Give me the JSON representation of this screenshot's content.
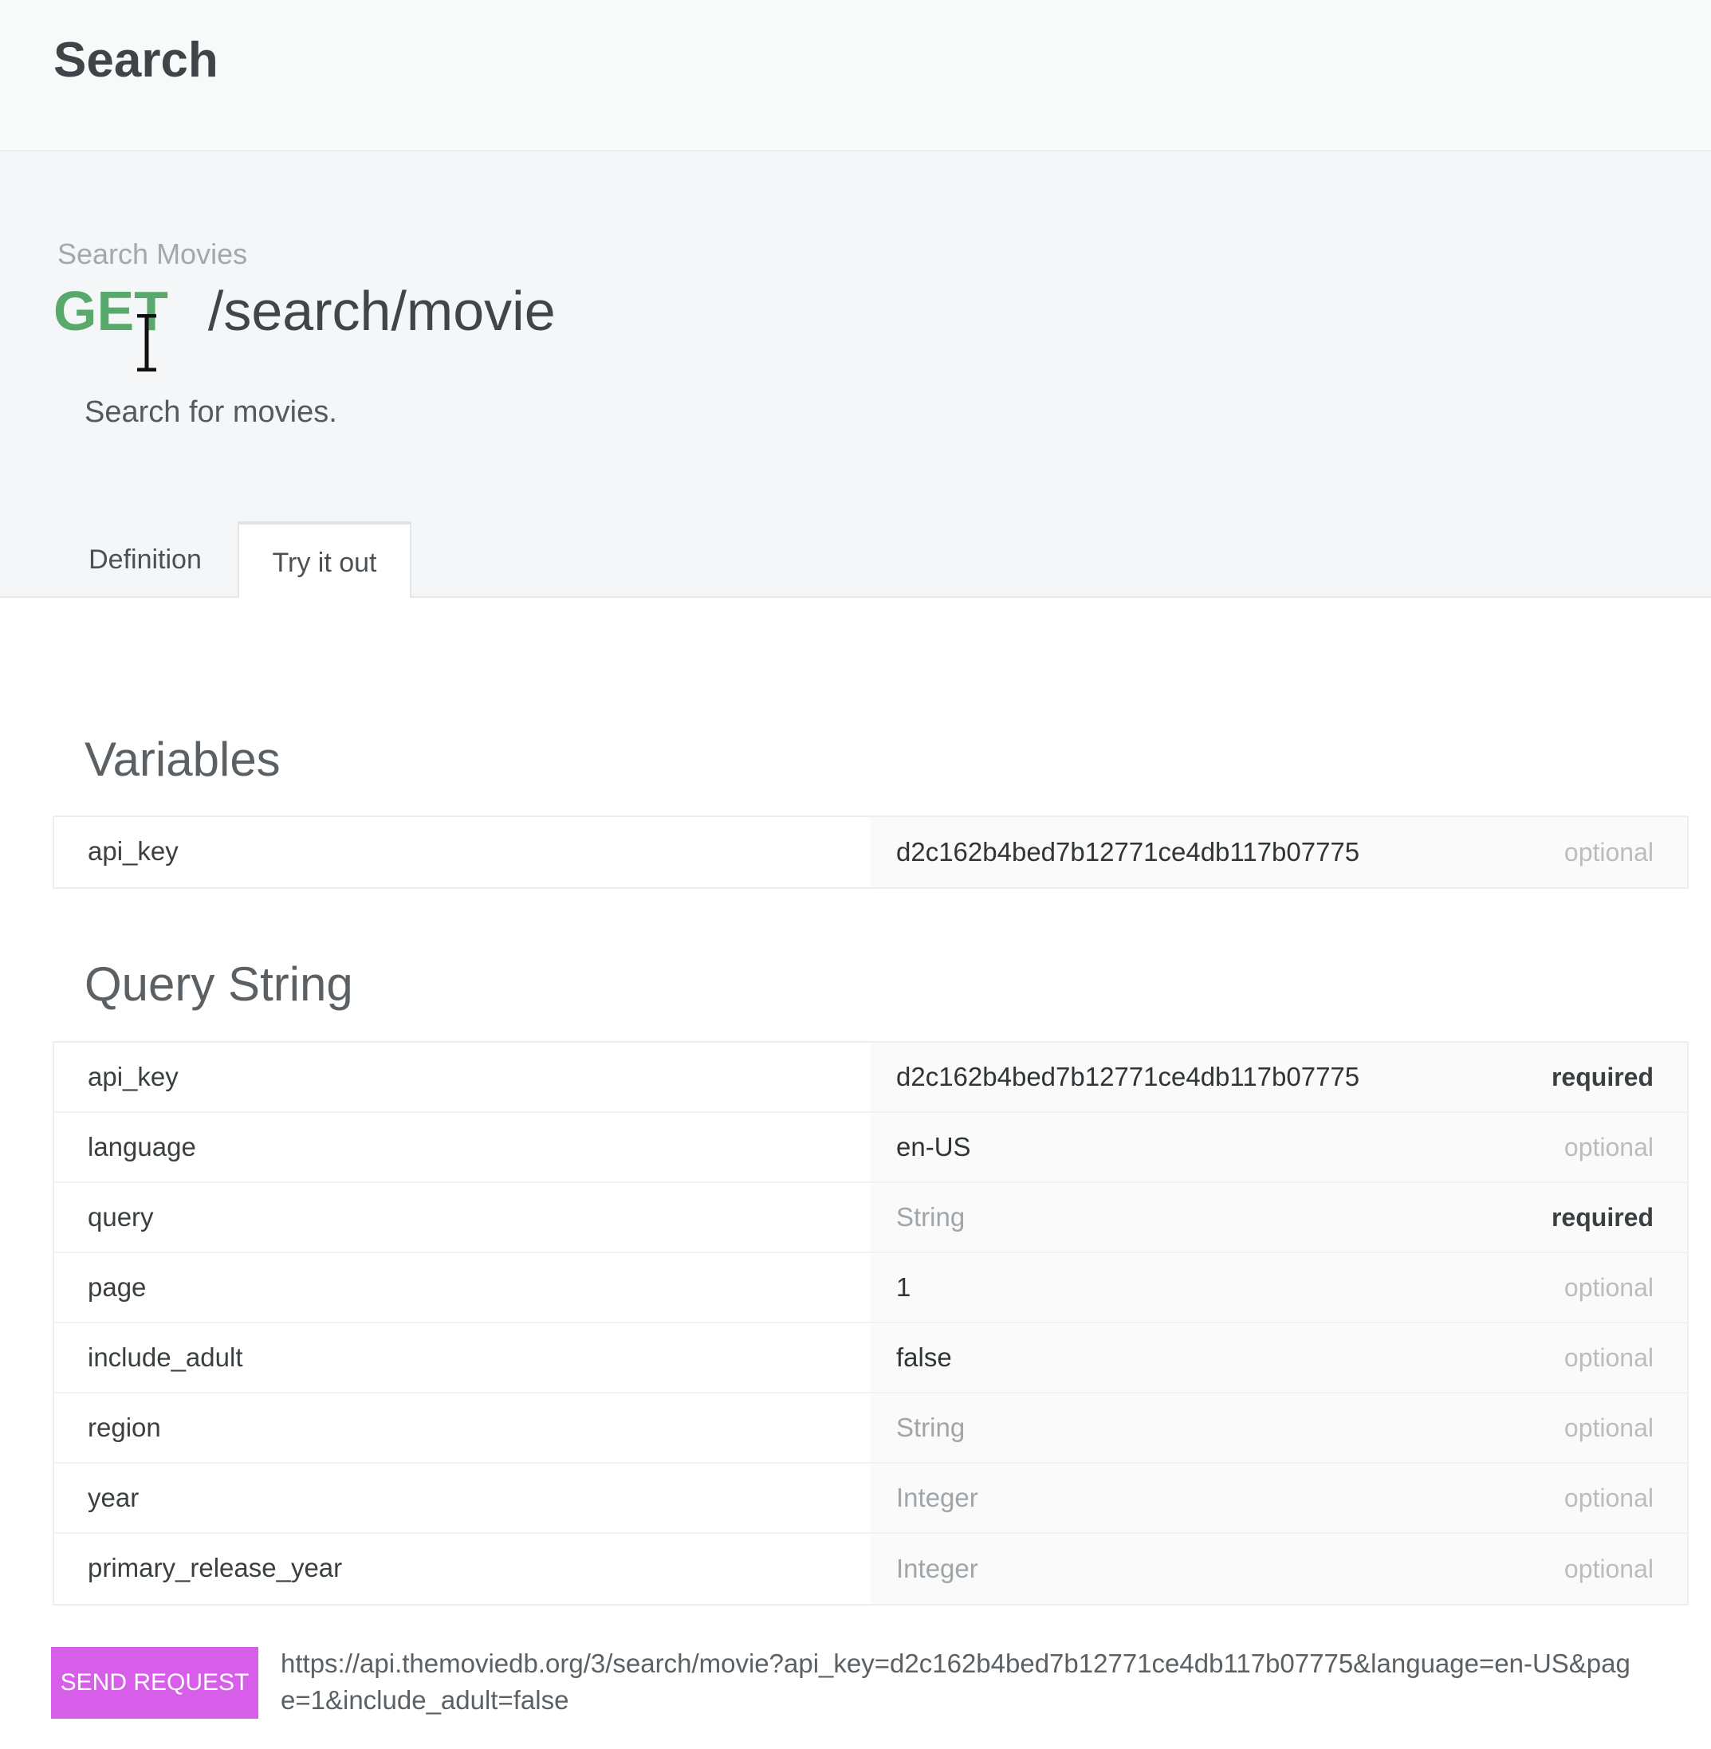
{
  "header": {
    "title": "Search"
  },
  "endpoint": {
    "name": "Search Movies",
    "method": "GET",
    "path": "/search/movie",
    "description": "Search for movies.",
    "method_color": "#5aa96c"
  },
  "tabs": [
    {
      "label": "Definition",
      "active": false
    },
    {
      "label": "Try it out",
      "active": true
    }
  ],
  "variables": {
    "title": "Variables",
    "rows": [
      {
        "name": "api_key",
        "value": "d2c162b4bed7b12771ce4db117b07775",
        "placeholder": "",
        "flag": "optional"
      }
    ]
  },
  "query_string": {
    "title": "Query String",
    "rows": [
      {
        "name": "api_key",
        "value": "d2c162b4bed7b12771ce4db117b07775",
        "placeholder": "",
        "flag": "required"
      },
      {
        "name": "language",
        "value": "en-US",
        "placeholder": "",
        "flag": "optional"
      },
      {
        "name": "query",
        "value": "",
        "placeholder": "String",
        "flag": "required"
      },
      {
        "name": "page",
        "value": "1",
        "placeholder": "",
        "flag": "optional"
      },
      {
        "name": "include_adult",
        "value": "false",
        "placeholder": "",
        "flag": "optional"
      },
      {
        "name": "region",
        "value": "",
        "placeholder": "String",
        "flag": "optional"
      },
      {
        "name": "year",
        "value": "",
        "placeholder": "Integer",
        "flag": "optional"
      },
      {
        "name": "primary_release_year",
        "value": "",
        "placeholder": "Integer",
        "flag": "optional"
      }
    ]
  },
  "request": {
    "button_label": "SEND REQUEST",
    "url": "https://api.themoviedb.org/3/search/movie?api_key=d2c162b4bed7b12771ce4db117b07775&language=en-US&page=1&include_adult=false",
    "button_color": "#d65ee9"
  }
}
